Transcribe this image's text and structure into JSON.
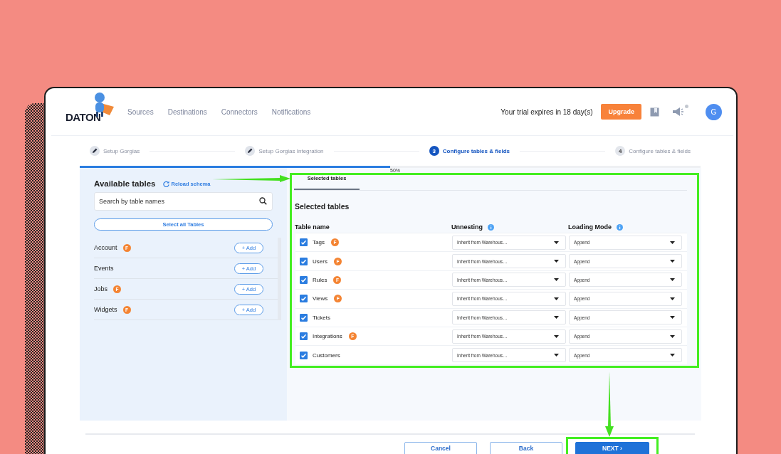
{
  "nav": {
    "logo": "DATON",
    "links": [
      "Sources",
      "Destinations",
      "Connectors",
      "Notifications"
    ],
    "trial": "Your trial expires in 18 day(s)",
    "upgrade": "Upgrade",
    "avatar": "G",
    "unread": true
  },
  "steps": [
    {
      "kind": "done",
      "label": "Setup Gorgias"
    },
    {
      "kind": "done",
      "label": "Setup Gorgias Integration"
    },
    {
      "kind": "current",
      "number": "3",
      "label": "Configure tables & fields"
    },
    {
      "kind": "pending",
      "number": "4",
      "label": "Configure tables & fields"
    }
  ],
  "progress": {
    "level": 0.5,
    "reading": "50%"
  },
  "available": {
    "title": "Available tables",
    "reload": "Reload schema",
    "search_placeholder": "Search by table names",
    "select_all": "Select all Tables",
    "tables": [
      {
        "name": "Account",
        "badge": "F",
        "add": "+ Add"
      },
      {
        "name": "Events",
        "add": "+ Add"
      },
      {
        "name": "Jobs",
        "badge": "F",
        "add": "+ Add"
      },
      {
        "name": "Widgets",
        "badge": "F",
        "add": "+ Add"
      }
    ]
  },
  "selected": {
    "tabs": [
      {
        "label": "Selected tables",
        "selected": true
      }
    ],
    "title": "Selected tables",
    "columns": [
      "Table name",
      "Unnesting",
      "Loading Mode"
    ],
    "rows": [
      {
        "name": "Tags",
        "badge": "F",
        "checked": true,
        "unnesting": "Inherit from Warehous…",
        "loading": "Append"
      },
      {
        "name": "Users",
        "badge": "F",
        "checked": true,
        "unnesting": "Inherit from Warehous…",
        "loading": "Append"
      },
      {
        "name": "Rules",
        "badge": "F",
        "checked": true,
        "unnesting": "Inherit from Warehous…",
        "loading": "Append"
      },
      {
        "name": "Views",
        "badge": "F",
        "checked": true,
        "unnesting": "Inherit from Warehous…",
        "loading": "Append"
      },
      {
        "name": "Tickets",
        "checked": true,
        "unnesting": "Inherit from Warehous…",
        "loading": "Append"
      },
      {
        "name": "Integrations",
        "badge": "F",
        "checked": true,
        "unnesting": "Inherit from Warehous…",
        "loading": "Append"
      },
      {
        "name": "Customers",
        "checked": true,
        "unnesting": "Inherit from Warehous…",
        "loading": "Append"
      }
    ]
  },
  "footer": {
    "buttons": [
      {
        "kind": "outline",
        "label": "Cancel"
      },
      {
        "kind": "outline",
        "label": "Back"
      },
      {
        "kind": "primary",
        "label": "NEXT ›"
      }
    ]
  }
}
